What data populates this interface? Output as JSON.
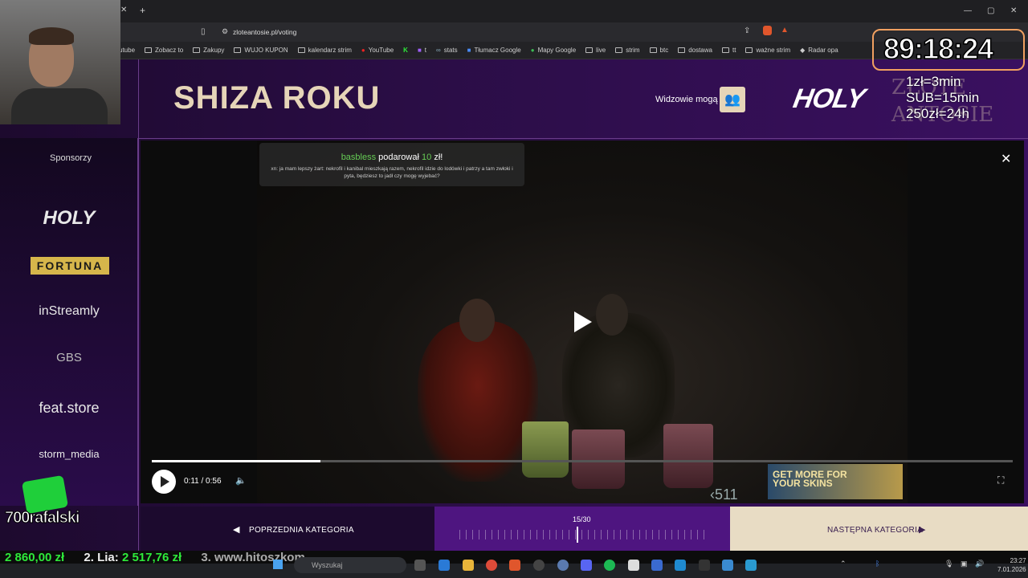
{
  "browser": {
    "url": "zloteantosie.pl/voting",
    "bookmarks": [
      "utube",
      "Zobacz to",
      "Zakupy",
      "WUJO KUPON",
      "kalendarz strim",
      "YouTube",
      "t",
      "stats",
      "Tłumacz Google",
      "Mapy Google",
      "live",
      "strim",
      "btc",
      "dostawa",
      "tt",
      "ważne strim",
      "Radar opa"
    ]
  },
  "header": {
    "title": "SHIZA ROKU",
    "viewers_label": "Widzowie mogą",
    "brand_logo": "HOLY",
    "brand_ghost": "ZŁOTE ANTOSIE"
  },
  "sidebar": {
    "label": "Sponsorzy",
    "sponsors": [
      "HOLY",
      "FORTUNA",
      "inStreamly",
      "GBS",
      "feat.store",
      "storm_media"
    ]
  },
  "donation": {
    "donor": "basbless",
    "action": "podarował",
    "amount": "10",
    "currency": "zł!",
    "message": "xn: ja mam lepszy żart: nekrofil i kanibal mieszkają razem, nekrofil idzie do lodówki i patrzy a tam zwłoki i pyta, będziesz to jadł czy mogę wyjebać?"
  },
  "player": {
    "time": "0:11 / 0:56",
    "progress": 0.196,
    "ad_text": "GET MORE FOR YOUR SKINS",
    "ad_count": "‹511"
  },
  "nav": {
    "prev_label": "POPRZEDNIA KATEGORIA",
    "counter": "15/30",
    "next_label": "NASTĘPNA KATEGORIA"
  },
  "overlay": {
    "timer": "89:18:24",
    "subathon_lines": [
      "1zł=3min",
      "SUB=15min",
      "250zł=24h"
    ],
    "kick_name": "700rafalski",
    "ticker": [
      "2 860,00 zł",
      "2. Lia:",
      "2 517,76 zł",
      "3. www.hitoszkom"
    ]
  },
  "taskbar": {
    "search_placeholder": "Wyszukaj",
    "time": "23:27",
    "date": "7.01.2026"
  },
  "colors": {
    "accent_gold": "#e6d5b8",
    "purple": "#4e1580",
    "donation_green": "#66cc55"
  }
}
